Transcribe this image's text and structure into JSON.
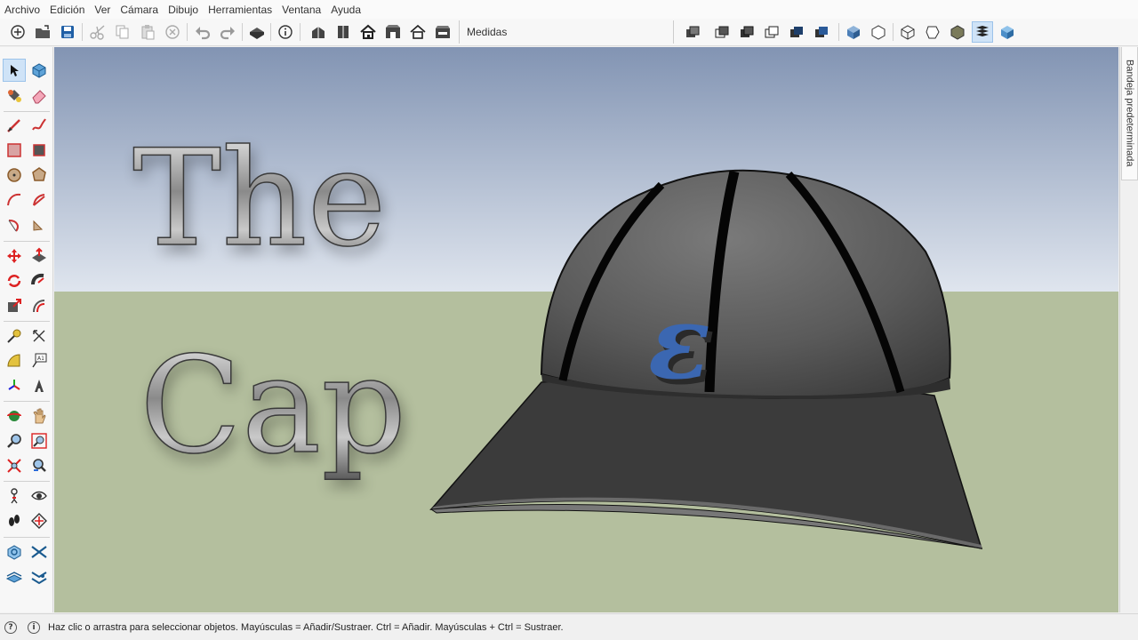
{
  "menu": [
    "Archivo",
    "Edición",
    "Ver",
    "Cámara",
    "Dibujo",
    "Herramientas",
    "Ventana",
    "Ayuda"
  ],
  "toolbar": {
    "measurements_label": "Medidas",
    "buttons": [
      "new-file-icon",
      "open-file-icon",
      "save-icon",
      "cut-icon",
      "copy-icon",
      "paste-icon",
      "erase-selection-icon",
      "undo-icon",
      "redo-icon",
      "print-icon",
      "model-info-icon",
      "iso-view-icon",
      "top-view-icon",
      "front-view-icon",
      "right-view-icon",
      "back-view-icon",
      "left-view-icon",
      "xray-icon",
      "back-edges-icon",
      "wireframe-icon",
      "hidden-line-icon",
      "shaded-icon",
      "shaded-textures-icon",
      "monochrome-icon",
      "sections-icon",
      "section-cut-icon",
      "section-fill-icon",
      "section-planes-icon",
      "styles-icon"
    ]
  },
  "tools": [
    "select",
    "component",
    "paint-bucket",
    "eraser",
    "line",
    "freehand",
    "rectangle",
    "rotated-rectangle",
    "circle",
    "polygon",
    "arc",
    "pie",
    "arc-3pt",
    "arc-2pt",
    "move",
    "push-pull",
    "rotate",
    "follow-me",
    "scale",
    "offset",
    "tape-measure",
    "dimension",
    "protractor",
    "text",
    "axes",
    "3d-text",
    "orbit",
    "pan",
    "zoom",
    "zoom-window",
    "zoom-extents",
    "previous-view",
    "position-camera",
    "look-around",
    "walk",
    "section-plane",
    "sandbox-from-contours",
    "sandbox-from-scratch",
    "smoove",
    "stamp"
  ],
  "scene": {
    "title_line1": "The",
    "title_line2": "Cap",
    "logo_letter": "ε"
  },
  "tray": {
    "label": "Bandeja predeterminada"
  },
  "status": {
    "text": "Haz clic o arrastra para seleccionar objetos. Mayúsculas = Añadir/Sustraer. Ctrl = Añadir. Mayúsculas + Ctrl = Sustraer."
  },
  "colors": {
    "sky_top": "#8497b5",
    "sky_bottom": "#dce3ec",
    "ground": "#b4bf9e",
    "cap_crown": "#5e5e5e",
    "cap_brim": "#3a3a3a",
    "logo": "#3b67b1",
    "accent_active": "#cfe3f7"
  }
}
